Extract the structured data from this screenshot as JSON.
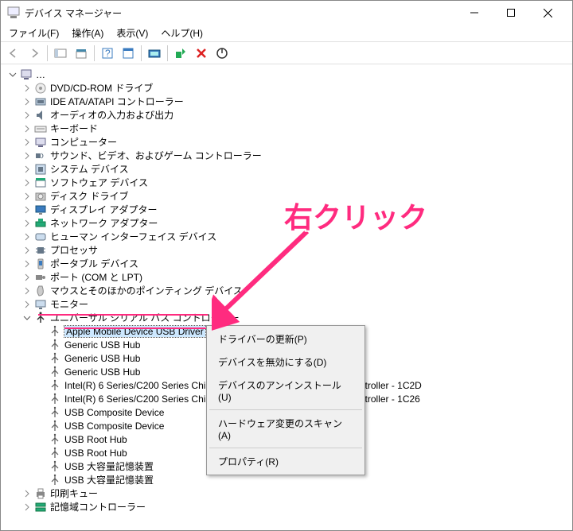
{
  "window": {
    "title": "デバイス マネージャー"
  },
  "menubar": {
    "file": "ファイル(F)",
    "action": "操作(A)",
    "view": "表示(V)",
    "help": "ヘルプ(H)"
  },
  "annotation": {
    "text": "右クリック"
  },
  "tree": {
    "root": "…",
    "nodes": [
      {
        "label": "DVD/CD-ROM ドライブ",
        "icon": "disc"
      },
      {
        "label": "IDE ATA/ATAPI コントローラー",
        "icon": "ide"
      },
      {
        "label": "オーディオの入力および出力",
        "icon": "audio"
      },
      {
        "label": "キーボード",
        "icon": "keyboard"
      },
      {
        "label": "コンピューター",
        "icon": "computer"
      },
      {
        "label": "サウンド、ビデオ、およびゲーム コントローラー",
        "icon": "sound"
      },
      {
        "label": "システム デバイス",
        "icon": "system"
      },
      {
        "label": "ソフトウェア デバイス",
        "icon": "software"
      },
      {
        "label": "ディスク ドライブ",
        "icon": "disk"
      },
      {
        "label": "ディスプレイ アダプター",
        "icon": "display"
      },
      {
        "label": "ネットワーク アダプター",
        "icon": "network"
      },
      {
        "label": "ヒューマン インターフェイス デバイス",
        "icon": "hid"
      },
      {
        "label": "プロセッサ",
        "icon": "cpu"
      },
      {
        "label": "ポータブル デバイス",
        "icon": "portable"
      },
      {
        "label": "ポート (COM と LPT)",
        "icon": "port"
      },
      {
        "label": "マウスとそのほかのポインティング デバイス",
        "icon": "mouse"
      },
      {
        "label": "モニター",
        "icon": "monitor"
      },
      {
        "label": "ユニバーサル シリアル バス コントローラー",
        "icon": "usb",
        "expanded": true
      }
    ],
    "usb_children": [
      {
        "label": "Apple Mobile Device USB Driver",
        "selected": true
      },
      {
        "label": "Generic USB Hub"
      },
      {
        "label": "Generic USB Hub"
      },
      {
        "label": "Generic USB Hub"
      },
      {
        "label": "Intel(R) 6 Series/C200 Series Chipset Family USB Enhanced Host Controller - 1C2D"
      },
      {
        "label": "Intel(R) 6 Series/C200 Series Chipset Family USB Enhanced Host Controller - 1C26"
      },
      {
        "label": "USB Composite Device"
      },
      {
        "label": "USB Composite Device"
      },
      {
        "label": "USB Root Hub"
      },
      {
        "label": "USB Root Hub"
      },
      {
        "label": "USB 大容量記憶装置"
      },
      {
        "label": "USB 大容量記憶装置"
      }
    ],
    "tail_nodes": [
      {
        "label": "印刷キュー",
        "icon": "printer"
      },
      {
        "label": "記憶域コントローラー",
        "icon": "storage"
      }
    ]
  },
  "context_menu": {
    "items": [
      "ドライバーの更新(P)",
      "デバイスを無効にする(D)",
      "デバイスのアンインストール(U)",
      "ハードウェア変更のスキャン(A)",
      "プロパティ(R)"
    ]
  }
}
